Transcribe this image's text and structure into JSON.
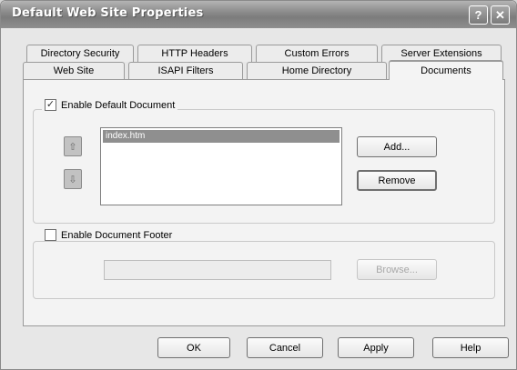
{
  "window": {
    "title": "Default Web Site Properties"
  },
  "titlebar": {
    "help_label": "?",
    "close_label": "✕"
  },
  "tabs_back": [
    "Directory Security",
    "HTTP Headers",
    "Custom Errors",
    "Server Extensions"
  ],
  "tabs_front": [
    "Web Site",
    "ISAPI Filters",
    "Home Directory",
    "Documents"
  ],
  "active_tab": "Documents",
  "default_document": {
    "label": "Enable Default Document",
    "checked": true,
    "items": [
      "index.htm"
    ],
    "move_up_label": "⇧",
    "move_down_label": "⇩",
    "add_label": "Add...",
    "remove_label": "Remove"
  },
  "footer": {
    "label": "Enable Document Footer",
    "checked": false,
    "path_value": "",
    "browse_label": "Browse..."
  },
  "buttons": {
    "ok": "OK",
    "cancel": "Cancel",
    "apply": "Apply",
    "help": "Help"
  }
}
